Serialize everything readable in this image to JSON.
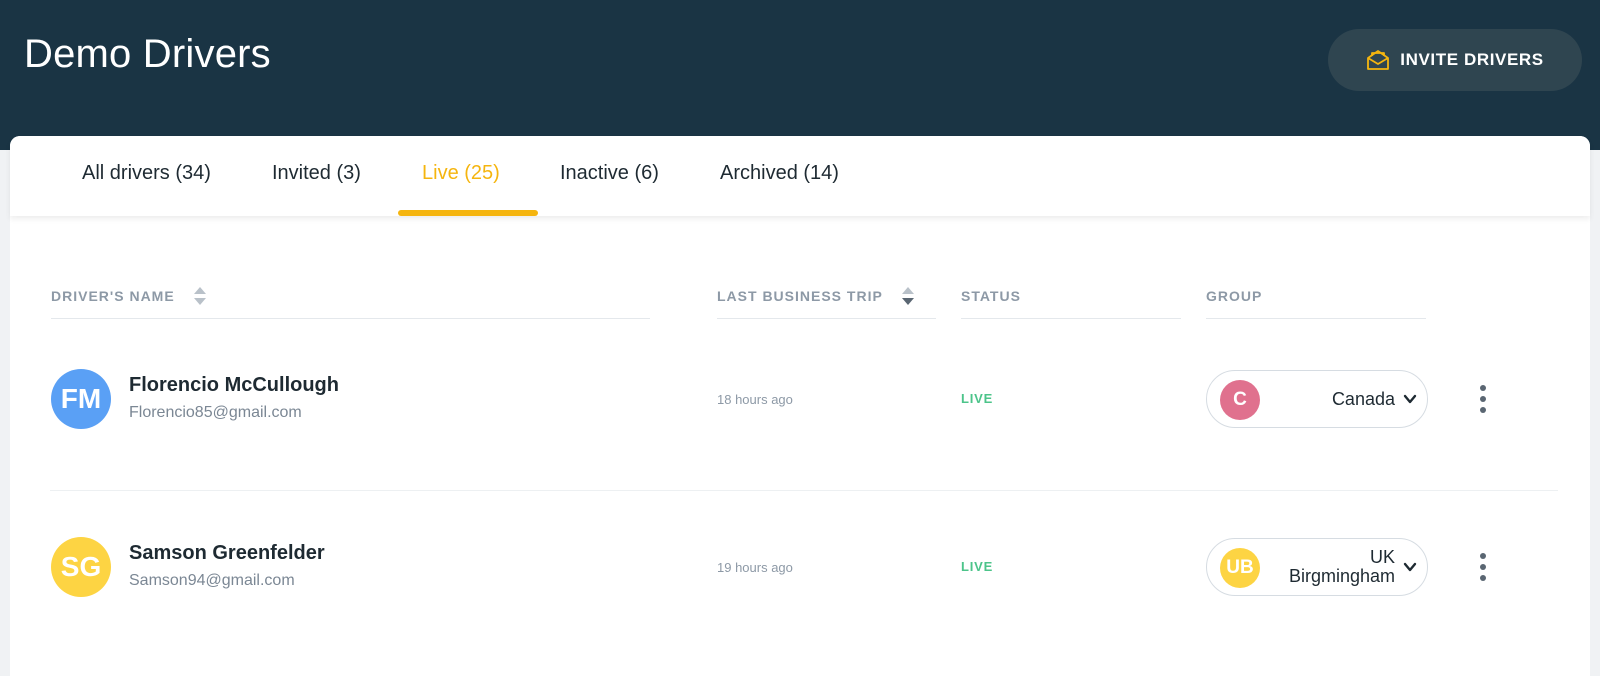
{
  "header": {
    "title": "Demo Drivers",
    "invite_button": {
      "label": "INVITE DRIVERS",
      "icon": "envelope-icon"
    }
  },
  "tabs": [
    {
      "label": "All drivers (34)",
      "active": false
    },
    {
      "label": "Invited (3)",
      "active": false
    },
    {
      "label": "Live (25)",
      "active": true
    },
    {
      "label": "Inactive (6)",
      "active": false
    },
    {
      "label": "Archived (14)",
      "active": false
    }
  ],
  "table": {
    "columns": {
      "name": "DRIVER'S NAME",
      "trip": "LAST BUSINESS TRIP",
      "status": "STATUS",
      "group": "GROUP"
    },
    "rows": [
      {
        "initials": "FM",
        "avatar_color": "#5aa0f5",
        "name": "Florencio McCullough",
        "email": "Florencio85@gmail.com",
        "last_trip": "18 hours ago",
        "status": "LIVE",
        "group": {
          "initials": "C",
          "color": "#e0718e",
          "name": "Canada"
        }
      },
      {
        "initials": "SG",
        "avatar_color": "#fdd443",
        "name": "Samson Greenfelder",
        "email": "Samson94@gmail.com",
        "last_trip": "19 hours ago",
        "status": "LIVE",
        "group": {
          "initials": "UB",
          "color": "#fdd443",
          "name_line1": "UK",
          "name_line2": "Birgmingham"
        }
      }
    ]
  },
  "colors": {
    "header_bg": "#1a3444",
    "accent": "#f5b50f",
    "status_live": "#4cc48a"
  }
}
